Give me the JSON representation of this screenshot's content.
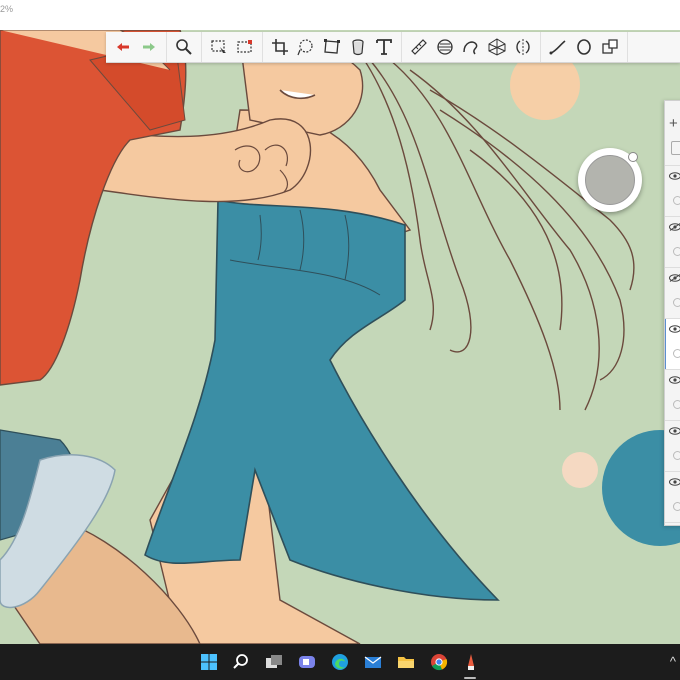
{
  "app": {
    "zoom_label": "2%"
  },
  "toolbar": {
    "tools": [
      {
        "icon": "undo-icon",
        "name": "undo"
      },
      {
        "icon": "redo-icon",
        "name": "redo"
      },
      {
        "icon": "magnifier-icon",
        "name": "zoom"
      },
      {
        "icon": "select-icon",
        "name": "select"
      },
      {
        "icon": "marquee-icon",
        "name": "marquee"
      },
      {
        "icon": "crop-icon",
        "name": "crop"
      },
      {
        "icon": "lasso-icon",
        "name": "lasso"
      },
      {
        "icon": "transform-icon",
        "name": "transform"
      },
      {
        "icon": "fill-bucket-icon",
        "name": "fill"
      },
      {
        "icon": "text-icon",
        "name": "text"
      },
      {
        "icon": "ruler-icon",
        "name": "ruler"
      },
      {
        "icon": "ellipse-guide-icon",
        "name": "ellipse-guide"
      },
      {
        "icon": "french-curve-icon",
        "name": "french-curve"
      },
      {
        "icon": "perspective-icon",
        "name": "perspective"
      },
      {
        "icon": "symmetry-icon",
        "name": "symmetry"
      },
      {
        "icon": "stroke-icon",
        "name": "stroke"
      },
      {
        "icon": "circle-icon",
        "name": "circle"
      },
      {
        "icon": "shapes-icon",
        "name": "shapes"
      }
    ]
  },
  "colors": {
    "canvas_bg": "#c4d7b8",
    "shirt": "#dc5434",
    "dress": "#3b8ea5",
    "skin": "#f5c9a0",
    "current_color": "#b3b4ae"
  },
  "layers_panel": {
    "add_icon": "+",
    "rows": [
      {
        "visible": true,
        "selected": false
      },
      {
        "visible": false,
        "selected": false
      },
      {
        "visible": false,
        "selected": false
      },
      {
        "visible": true,
        "selected": true
      },
      {
        "visible": true,
        "selected": false
      },
      {
        "visible": true,
        "selected": false
      },
      {
        "visible": true,
        "selected": false
      }
    ]
  },
  "taskbar": {
    "icons": [
      "windows-start-icon",
      "search-icon",
      "task-view-icon",
      "teams-chat-icon",
      "edge-browser-icon",
      "mail-icon",
      "file-explorer-icon",
      "chrome-icon",
      "sketchbook-app-icon"
    ],
    "tray_chevron": "^"
  }
}
